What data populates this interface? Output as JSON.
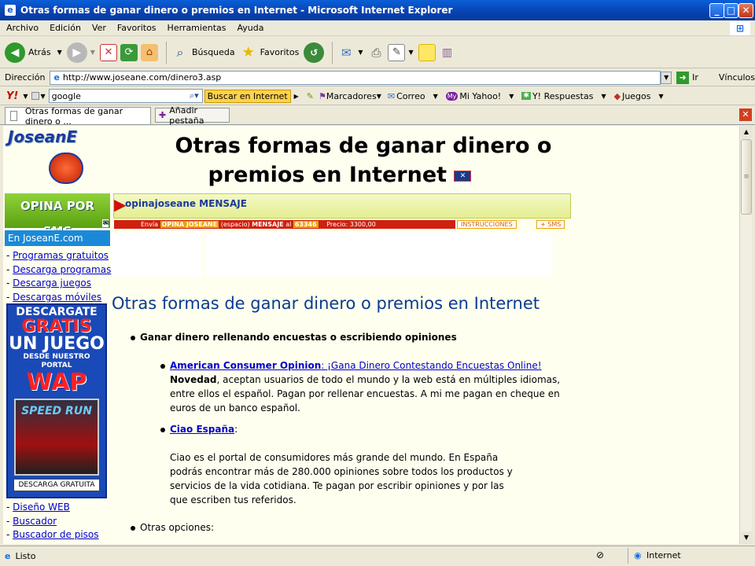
{
  "window": {
    "title": "Otras formas de ganar dinero o premios en Internet - Microsoft Internet Explorer"
  },
  "menu": [
    "Archivo",
    "Edición",
    "Ver",
    "Favoritos",
    "Herramientas",
    "Ayuda"
  ],
  "toolbar": {
    "back": "Atrás",
    "search": "Búsqueda",
    "favorites": "Favoritos"
  },
  "address": {
    "label": "Dirección",
    "url": "http://www.joseane.com/dinero3.asp",
    "go": "Ir",
    "links": "Vínculos"
  },
  "yahoo": {
    "search_value": "google",
    "search_button": "Buscar en Internet",
    "bookmarks": "Marcadores",
    "mail": "Correo",
    "myyahoo": "Mi Yahoo!",
    "answers": "Y! Respuestas",
    "games": "Juegos"
  },
  "tabs": {
    "active": "Otras formas de ganar dinero o ...",
    "new_tab": "Añadir pestaña"
  },
  "page": {
    "logo": "JoseanE",
    "title_line1": "Otras formas de ganar dinero o",
    "title_line2": "premios en Internet",
    "opina_banner": "OPINA POR SMS",
    "opina_message": "opinajoseane MENSAJE",
    "opina_instructions_a": "Envía",
    "opina_instructions_b": "OPINA JOSEANE",
    "opina_instructions_c": "(espacio)",
    "opina_instructions_d": "MENSAJE",
    "opina_instructions_e": "al",
    "opina_instructions_f": "63346",
    "opina_price": "Precio: 3300,00",
    "opina_link1": "INSTRUCCIONES",
    "opina_link2": "+ SMS",
    "section_title": "Otras formas de ganar dinero o premios en Internet",
    "bullet1": "Ganar dinero rellenando encuestas o escribiendo opiniones",
    "aco_link": "American Consumer Opinion",
    "aco_tagline": ": ¡Gana Dinero Contestando Encuestas Online!",
    "aco_bold": "Novedad",
    "aco_l1": ", aceptan usuarios de todo el mundo y la web está en múltiples idiomas,",
    "aco_l2": "entre ellos el español. Pagan por rellenar encuestas. A mi me pagan en cheque en",
    "aco_l3": "euros de un banco español.",
    "ciao_link": "Ciao España",
    "ciao_colon": ":",
    "ciao_l1": "Ciao es el portal de consumidores más grande del mundo. En España",
    "ciao_l2": "podrás encontrar más de 280.000 opiniones sobre todos los productos y",
    "ciao_l3": "servicios de la vida cotidiana. Te pagan por escribir opiniones y por las",
    "ciao_l4": "que escriben tus referidos.",
    "bullet2": "Otras opciones:"
  },
  "sidebar": {
    "header": "En JoseanE.com",
    "items_top": [
      "Programas gratuitos",
      "Descarga programas",
      "Descarga juegos",
      "Descargas móviles"
    ],
    "ad_line1": "DESCARGATE",
    "ad_line2": "GRATIS",
    "ad_line3": "UN JUEGO",
    "ad_line4": "DESDE NUESTRO PORTAL",
    "ad_line5": "WAP",
    "ad_game": "SPEED RUN",
    "ad_button": "DESCARGA GRATUITA",
    "items_bottom": [
      "Diseño WEB",
      "Buscador",
      "Buscador de pisos"
    ]
  },
  "status": {
    "text": "Listo",
    "zone": "Internet"
  }
}
